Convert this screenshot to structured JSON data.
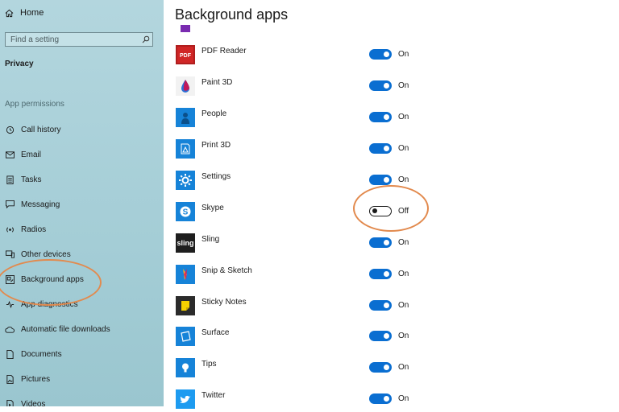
{
  "sidebar": {
    "home_label": "Home",
    "search_placeholder": "Find a setting",
    "section_title": "Privacy",
    "group_title": "App permissions",
    "items": [
      {
        "label": "Call history",
        "icon": "call-history-icon"
      },
      {
        "label": "Email",
        "icon": "email-icon"
      },
      {
        "label": "Tasks",
        "icon": "tasks-icon"
      },
      {
        "label": "Messaging",
        "icon": "messaging-icon"
      },
      {
        "label": "Radios",
        "icon": "radios-icon"
      },
      {
        "label": "Other devices",
        "icon": "other-devices-icon"
      },
      {
        "label": "Background apps",
        "icon": "background-apps-icon"
      },
      {
        "label": "App diagnostics",
        "icon": "app-diagnostics-icon"
      },
      {
        "label": "Automatic file downloads",
        "icon": "cloud-icon"
      },
      {
        "label": "Documents",
        "icon": "document-icon"
      },
      {
        "label": "Pictures",
        "icon": "pictures-icon"
      },
      {
        "label": "Videos",
        "icon": "videos-icon"
      }
    ]
  },
  "main": {
    "title": "Background apps",
    "apps": [
      {
        "name": "PDF Reader",
        "state": "On",
        "icon": "pdf-reader-icon"
      },
      {
        "name": "Paint 3D",
        "state": "On",
        "icon": "paint-3d-icon"
      },
      {
        "name": "People",
        "state": "On",
        "icon": "people-icon"
      },
      {
        "name": "Print 3D",
        "state": "On",
        "icon": "print-3d-icon"
      },
      {
        "name": "Settings",
        "state": "On",
        "icon": "settings-gear-icon"
      },
      {
        "name": "Skype",
        "state": "Off",
        "icon": "skype-icon"
      },
      {
        "name": "Sling",
        "state": "On",
        "icon": "sling-icon",
        "icon_text": "sling"
      },
      {
        "name": "Snip & Sketch",
        "state": "On",
        "icon": "snip-sketch-icon"
      },
      {
        "name": "Sticky Notes",
        "state": "On",
        "icon": "sticky-notes-icon"
      },
      {
        "name": "Surface",
        "state": "On",
        "icon": "surface-icon"
      },
      {
        "name": "Tips",
        "state": "On",
        "icon": "tips-icon"
      },
      {
        "name": "Twitter",
        "state": "On",
        "icon": "twitter-icon"
      }
    ]
  },
  "colors": {
    "toggle_on": "#0a6ed1",
    "annotation_circle": "#e28a4e",
    "sidebar_bg": "#a8d0d8"
  }
}
